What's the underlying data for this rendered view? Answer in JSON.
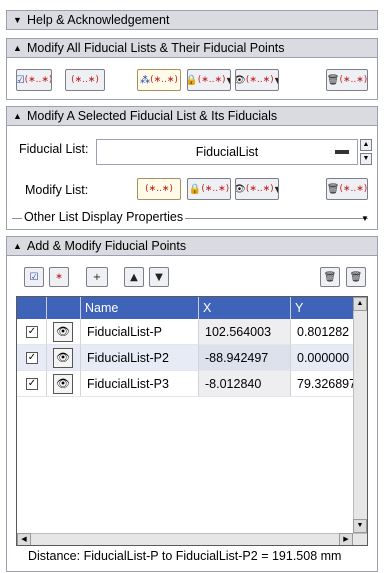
{
  "sections": {
    "help": {
      "title": "Help & Acknowledgement"
    },
    "modify_all": {
      "title": "Modify All Fiducial Lists & Their Fiducial Points"
    },
    "modify_selected": {
      "title": "Modify A Selected Fiducial List & Its Fiducials"
    },
    "add_modify": {
      "title": "Add & Modify Fiducial Points"
    }
  },
  "selected_list": {
    "list_label": "Fiducial List:",
    "list_value": "FiducialList",
    "modify_label": "Modify List:",
    "other_props_label": "Other List Display Properties"
  },
  "icons": {
    "asterisk": "(∗..∗)",
    "lock": "🔒",
    "eye": "👁",
    "trash": "🗑",
    "plus": "+",
    "up": "▲",
    "down": "▼",
    "chevron": "▼",
    "check": "✓"
  },
  "table": {
    "columns": [
      "Name",
      "X",
      "Y"
    ],
    "rows": [
      {
        "name": "FiducialList-P",
        "x": "102.564003",
        "y": "0.801282",
        "checked": true
      },
      {
        "name": "FiducialList-P2",
        "x": "-88.942497",
        "y": "0.000000",
        "checked": true
      },
      {
        "name": "FiducialList-P3",
        "x": "-8.012840",
        "y": "79.326897",
        "checked": true
      }
    ]
  },
  "status": {
    "distance_text": "Distance: FiducialList-P to FiducialList-P2 = 191.508 mm"
  }
}
